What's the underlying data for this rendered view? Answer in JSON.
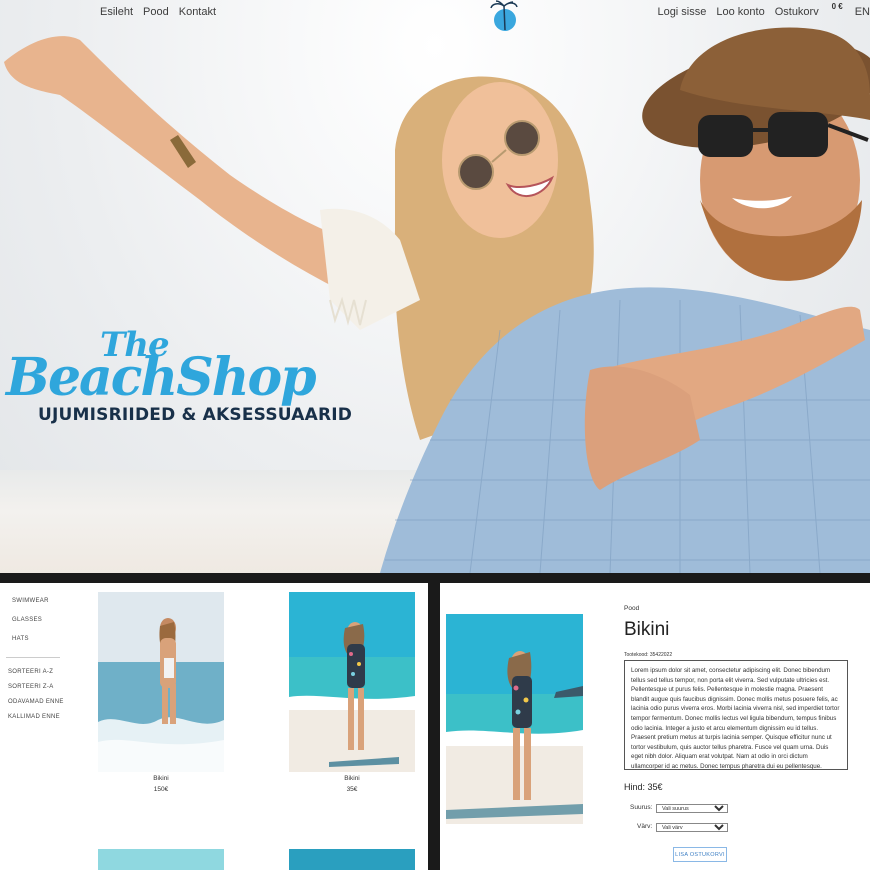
{
  "nav": {
    "home": "Esileht",
    "shop": "Pood",
    "contact": "Kontakt",
    "login": "Logi sisse",
    "register": "Loo konto",
    "cart": "Ostukorv",
    "cart_total": "0 €",
    "lang": "EN"
  },
  "brand": {
    "the": "The",
    "name": "BeachShop",
    "tagline": "UJUMISRIIDED & AKSESSUAARID",
    "color": "#2fa6dc"
  },
  "shop": {
    "categories": [
      "SWIMWEAR",
      "GLASSES",
      "HATS"
    ],
    "sorts": [
      "SORTEERI A-Z",
      "SORTEERI Z-A",
      "ODAVAMAD ENNE",
      "KALLIMAD ENNE"
    ],
    "products": [
      {
        "name": "Bikini",
        "price": "150€"
      },
      {
        "name": "Bikini",
        "price": "35€"
      }
    ]
  },
  "detail": {
    "breadcrumb": "Pood",
    "title": "Bikini",
    "sku": "Tootekood: 35422022",
    "description": "Lorem ipsum dolor sit amet, consectetur adipiscing elit. Donec bibendum tellus sed tellus tempor, non porta elit viverra. Sed vulputate ultricies est. Pellentesque ut purus felis. Pellentesque in molestie magna. Praesent blandit augue quis faucibus dignissim. Donec mollis metus posuere felis, ac lacinia odio purus viverra eros. Morbi lacinia viverra nisl, sed imperdiet tortor tempor fermentum. Donec mollis lectus vel ligula bibendum, tempus finibus odio lacinia. Integer a justo et arcu elementum dignissim eu id tellus. Praesent pretium metus at turpis lacinia semper. Quisque efficitur nunc ut tortor vestibulum, quis auctor tellus pharetra. Fusce vel quam urna. Duis eget nibh dolor. Aliquam erat volutpat. Nam at odio in orci dictum ullamcorper id ac metus. Donec tempus pharetra dui eu pellentesque.",
    "price": "Hind: 35€",
    "size_label": "Suurus:",
    "size_value": "Vali suurus",
    "color_label": "Värv:",
    "color_value": "Vali värv",
    "add_button": "LISA OSTUKORVI"
  }
}
